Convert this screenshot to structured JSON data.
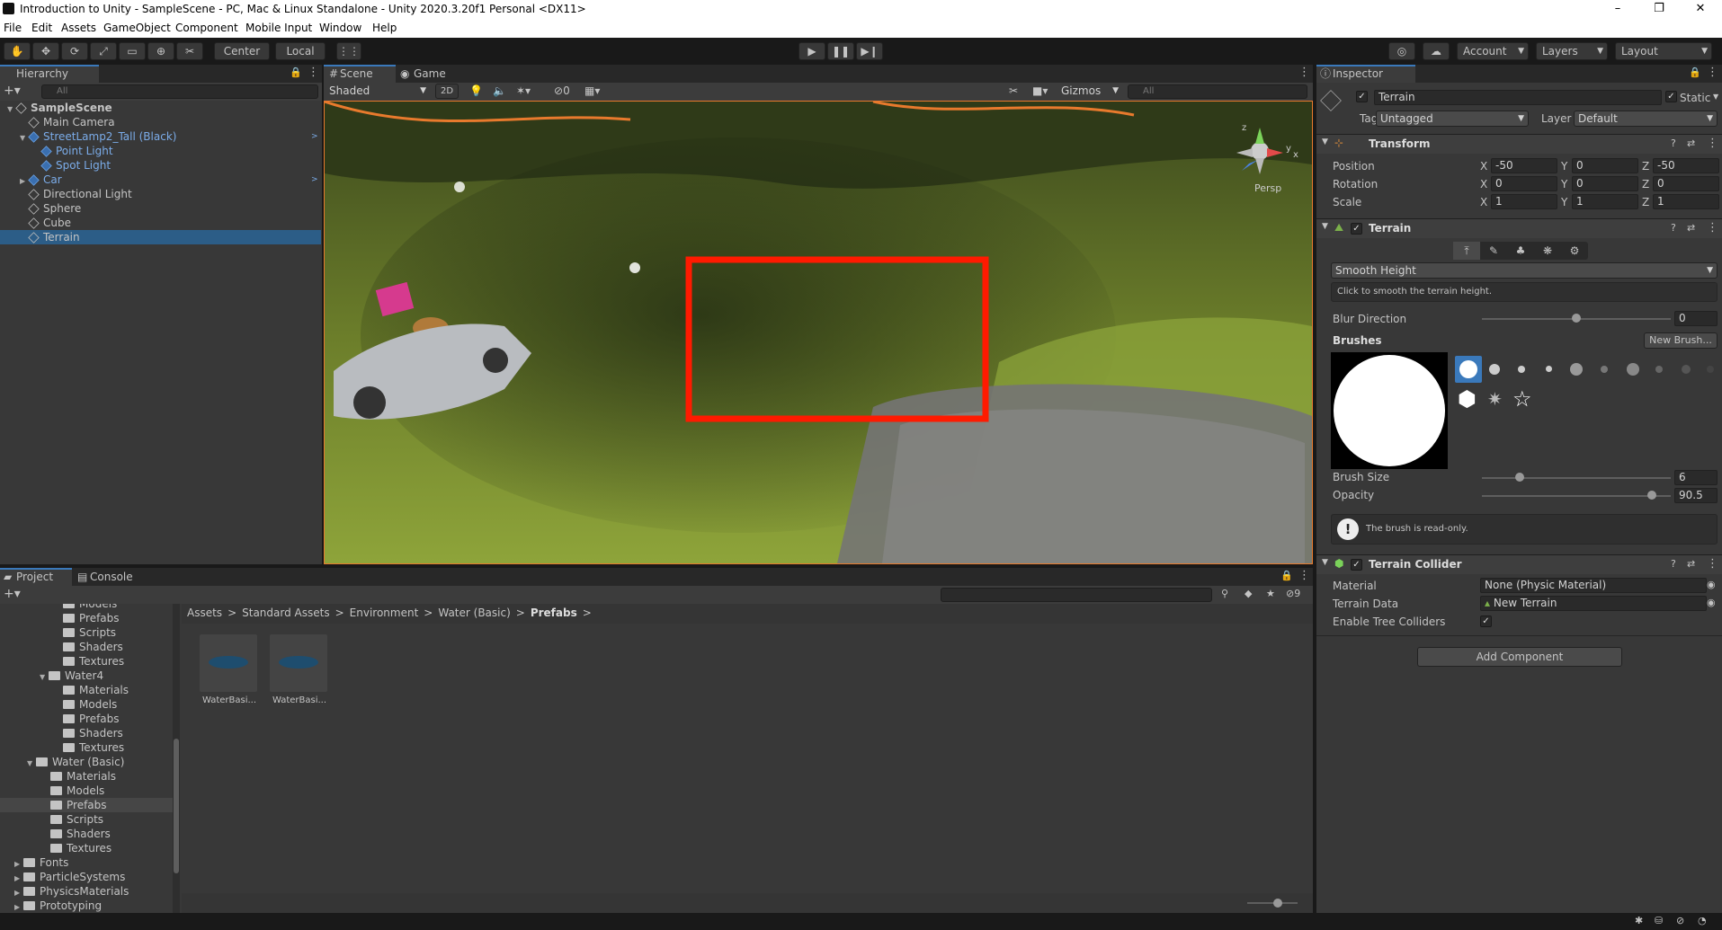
{
  "title_bar": {
    "title": "Introduction to Unity - SampleScene - PC, Mac & Linux Standalone - Unity 2020.3.20f1 Personal <DX11>",
    "minimize": "–",
    "maximize": "❐",
    "close": "✕"
  },
  "menu": [
    "File",
    "Edit",
    "Assets",
    "GameObject",
    "Component",
    "Mobile Input",
    "Window",
    "Help"
  ],
  "toolbar": {
    "pivot": "Center",
    "space": "Local",
    "account": "Account",
    "layers": "Layers",
    "layout": "Layout"
  },
  "hierarchy": {
    "tab": "Hierarchy",
    "search_placeholder": "All",
    "items": [
      {
        "label": "SampleScene",
        "depth": 0,
        "kind": "scene"
      },
      {
        "label": "Main Camera",
        "depth": 1,
        "kind": "obj"
      },
      {
        "label": "StreetLamp2_Tall (Black)",
        "depth": 1,
        "kind": "prefab"
      },
      {
        "label": "Point Light",
        "depth": 2,
        "kind": "prefab"
      },
      {
        "label": "Spot Light",
        "depth": 2,
        "kind": "prefab"
      },
      {
        "label": "Car",
        "depth": 1,
        "kind": "prefab"
      },
      {
        "label": "Directional Light",
        "depth": 1,
        "kind": "obj"
      },
      {
        "label": "Sphere",
        "depth": 1,
        "kind": "obj"
      },
      {
        "label": "Cube",
        "depth": 1,
        "kind": "obj"
      },
      {
        "label": "Terrain",
        "depth": 1,
        "kind": "obj",
        "selected": true
      }
    ]
  },
  "scene": {
    "tabs": [
      "Scene",
      "Game"
    ],
    "shading": "Shaded",
    "mode_2d": "2D",
    "hidden_count": "0",
    "gizmos": "Gizmos",
    "search_placeholder": "All",
    "persp_label": "Persp",
    "gizmo_axes": {
      "y": "y",
      "x": "x",
      "z": "z"
    },
    "highlight_color": "#ff1a00"
  },
  "project": {
    "tabs": [
      "Project",
      "Console"
    ],
    "badge": "9",
    "breadcrumb": [
      "Assets",
      "Standard Assets",
      "Environment",
      "Water (Basic)",
      "Prefabs"
    ],
    "tree": [
      {
        "label": "Models",
        "depth": 3,
        "partial": true
      },
      {
        "label": "Prefabs",
        "depth": 3
      },
      {
        "label": "Scripts",
        "depth": 3
      },
      {
        "label": "Shaders",
        "depth": 3
      },
      {
        "label": "Textures",
        "depth": 3
      },
      {
        "label": "Water4",
        "depth": 2,
        "open": true
      },
      {
        "label": "Materials",
        "depth": 3
      },
      {
        "label": "Models",
        "depth": 3
      },
      {
        "label": "Prefabs",
        "depth": 3
      },
      {
        "label": "Shaders",
        "depth": 3
      },
      {
        "label": "Textures",
        "depth": 3
      },
      {
        "label": "Water (Basic)",
        "depth": 1,
        "open": true
      },
      {
        "label": "Materials",
        "depth": 2
      },
      {
        "label": "Models",
        "depth": 2
      },
      {
        "label": "Prefabs",
        "depth": 2,
        "selected": true
      },
      {
        "label": "Scripts",
        "depth": 2
      },
      {
        "label": "Shaders",
        "depth": 2
      },
      {
        "label": "Textures",
        "depth": 2
      },
      {
        "label": "Fonts",
        "depth": 0,
        "closed": true
      },
      {
        "label": "ParticleSystems",
        "depth": 0,
        "closed": true
      },
      {
        "label": "PhysicsMaterials",
        "depth": 0,
        "closed": true
      },
      {
        "label": "Prototyping",
        "depth": 0,
        "closed": true
      }
    ],
    "assets": [
      {
        "label": "WaterBasi..."
      },
      {
        "label": "WaterBasi..."
      }
    ]
  },
  "inspector": {
    "tab": "Inspector",
    "object_name": "Terrain",
    "static_label": "Static",
    "tag_label": "Tag",
    "tag": "Untagged",
    "layer_label": "Layer",
    "layer": "Default",
    "transform": {
      "title": "Transform",
      "rows": [
        {
          "label": "Position",
          "x": "-50",
          "y": "0",
          "z": "-50"
        },
        {
          "label": "Rotation",
          "x": "0",
          "y": "0",
          "z": "0"
        },
        {
          "label": "Scale",
          "x": "1",
          "y": "1",
          "z": "1"
        }
      ]
    },
    "terrain": {
      "title": "Terrain",
      "tool": "Smooth Height",
      "help": "Click to smooth the terrain height.",
      "blur_label": "Blur Direction",
      "blur_value": "0",
      "blur_fraction": 0.5,
      "brushes_label": "Brushes",
      "new_brush": "New Brush...",
      "brush_size_label": "Brush Size",
      "brush_size": "6",
      "brush_size_fraction": 0.2,
      "opacity_label": "Opacity",
      "opacity": "90.5",
      "opacity_fraction": 0.9,
      "readonly_note": "The brush is read-only."
    },
    "collider": {
      "title": "Terrain Collider",
      "material_label": "Material",
      "material": "None (Physic Material)",
      "data_label": "Terrain Data",
      "data": "New Terrain",
      "trees_label": "Enable Tree Colliders"
    },
    "add_component": "Add Component"
  }
}
